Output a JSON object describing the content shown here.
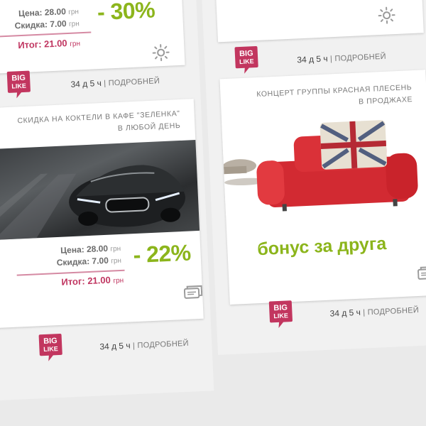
{
  "colors": {
    "green": "#8cb51c",
    "pink": "#c03560",
    "badge": "#c2365f",
    "text": "#444444"
  },
  "brand": {
    "badge_line1": "BIG",
    "badge_line2": "LIKE"
  },
  "cards": {
    "top_left": {
      "price": "Цена: 28.00",
      "price_unit": "грн",
      "discount": "Скидка: 7.00",
      "discount_unit": "грн",
      "total": "Итог: 21.00",
      "total_unit": "грн",
      "percent": "- 30%",
      "icon": "sun-icon",
      "timer": "34 д  5 ч",
      "more": "| ПОДРОБНЕЙ"
    },
    "top_right": {
      "icon": "sun-icon",
      "timer": "34 д  5 ч",
      "more": "| ПОДРОБНЕЙ"
    },
    "car": {
      "caption_line1": "СКИДКА НА КОКТЕЛИ  В КАФЕ \"ЗЕЛЕНКА\"",
      "caption_line2": "В ЛЮБОЙ ДЕНЬ",
      "price": "Цена: 28.00",
      "price_unit": "грн",
      "discount": "Скидка: 7.00",
      "discount_unit": "грн",
      "total": "Итог: 21.00",
      "total_unit": "грн",
      "percent": "- 22%",
      "icon": "tickets-icon",
      "timer": "34 д  5 ч",
      "more": "| ПОДРОБНЕЙ"
    },
    "concert": {
      "caption_line1": "КОНЦЕРТ ГРУППЫ КРАСНАЯ ПЛЕСЕНЬ",
      "caption_line2": "В ПРОДЖАХЕ",
      "bonus": "бонус за друга",
      "icon": "tickets-icon",
      "timer": "34 д  5 ч",
      "more": "| ПОДРОБНЕЙ"
    }
  }
}
